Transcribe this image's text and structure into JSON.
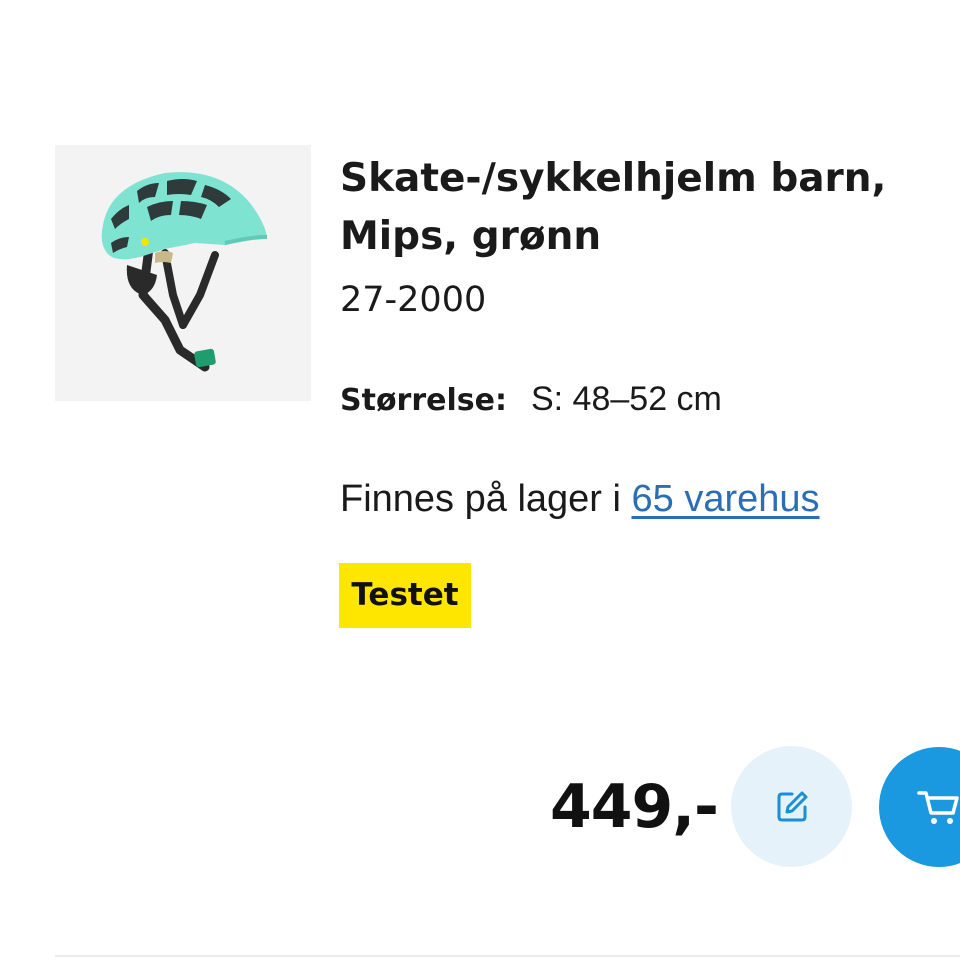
{
  "product": {
    "image_alt": "Skate-/sykkelhjelm barn, Mips, grønn",
    "title_line1": "Skate-/sykkelhjelm barn,",
    "title_line2": "Mips, grønn",
    "article_number": "27-2000"
  },
  "size": {
    "label": "Størrelse:",
    "value": "S: 48–52 cm"
  },
  "stock": {
    "text": "Finnes på lager i ",
    "link": "65 varehus"
  },
  "badge": {
    "label": "Testet",
    "color": "#ffe600"
  },
  "price": {
    "value": "449,-"
  },
  "actions": {
    "note_icon": "edit-note-icon",
    "cart_icon": "cart-icon",
    "note_bg": "#e6f2fa",
    "cart_bg": "#1a99e0"
  },
  "colors": {
    "link": "#2a6fb5",
    "helmet": "#7fe3d2"
  }
}
